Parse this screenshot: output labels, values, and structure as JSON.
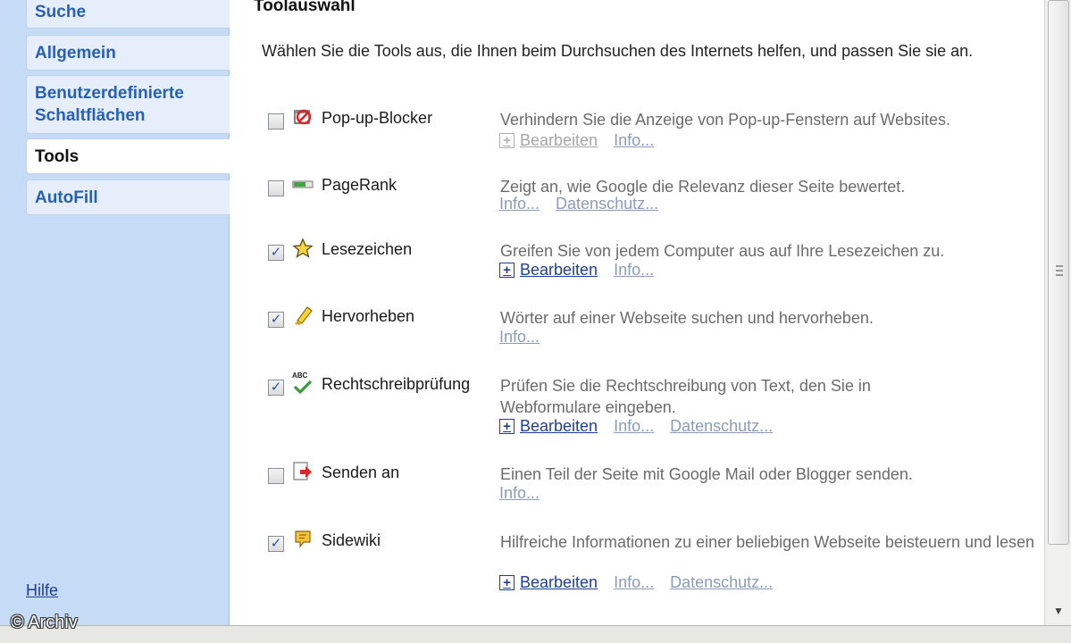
{
  "sidebar": {
    "tabs": [
      {
        "label": "Suche"
      },
      {
        "label": "Allgemein"
      },
      {
        "label": "Benutzerdefinierte Schaltflächen"
      },
      {
        "label": "Tools"
      },
      {
        "label": "AutoFill"
      }
    ],
    "help_label": "Hilfe"
  },
  "watermark": "© Archiv",
  "main": {
    "title": "Toolauswahl",
    "intro": "Wählen Sie die Tools aus, die Ihnen beim Durchsuchen des Internets helfen, und passen Sie sie an.",
    "tools": [
      {
        "name": "Pop-up-Blocker",
        "checked": false,
        "icon": "popup-blocker-icon",
        "description": "Verhindern Sie die Anzeige von Pop-up-Fenstern auf Websites.",
        "edit": "Bearbeiten",
        "info": "Info...",
        "privacy": ""
      },
      {
        "name": "PageRank",
        "checked": false,
        "icon": "pagerank-icon",
        "description": "Zeigt an, wie Google die Relevanz dieser Seite bewertet.",
        "edit": "",
        "info": "Info...",
        "privacy": "Datenschutz..."
      },
      {
        "name": "Lesezeichen",
        "checked": true,
        "icon": "star-icon",
        "description": "Greifen Sie von jedem Computer aus auf Ihre Lesezeichen zu.",
        "edit": "Bearbeiten",
        "info": "Info...",
        "privacy": ""
      },
      {
        "name": "Hervorheben",
        "checked": true,
        "icon": "highlighter-icon",
        "description": "Wörter auf einer Webseite suchen und hervorheben.",
        "edit": "",
        "info": "Info...",
        "privacy": ""
      },
      {
        "name": "Rechtschreibprüfung",
        "checked": true,
        "icon": "spellcheck-icon",
        "description": "Prüfen Sie die Rechtschreibung von Text, den Sie in Webformulare eingeben.",
        "edit": "Bearbeiten",
        "info": "Info...",
        "privacy": "Datenschutz..."
      },
      {
        "name": "Senden an",
        "checked": false,
        "icon": "send-to-icon",
        "description": "Einen Teil der Seite mit Google Mail oder Blogger senden.",
        "edit": "",
        "info": "Info...",
        "privacy": ""
      },
      {
        "name": "Sidewiki",
        "checked": true,
        "icon": "sidewiki-icon",
        "description": "Hilfreiche Informationen zu einer beliebigen Webseite beisteuern und lesen",
        "edit": "Bearbeiten",
        "info": "Info...",
        "privacy": "Datenschutz..."
      }
    ],
    "check_mark": "✓",
    "plus_sign": "+",
    "icon_text_abc": "ABC"
  },
  "colors": {
    "sidebar_bg": "#c6dbf5",
    "tab_text": "#2760b5",
    "link": "#1f3e99",
    "muted_link": "#8c9bb8"
  },
  "scrollbar": {
    "down_arrow": "▼"
  }
}
